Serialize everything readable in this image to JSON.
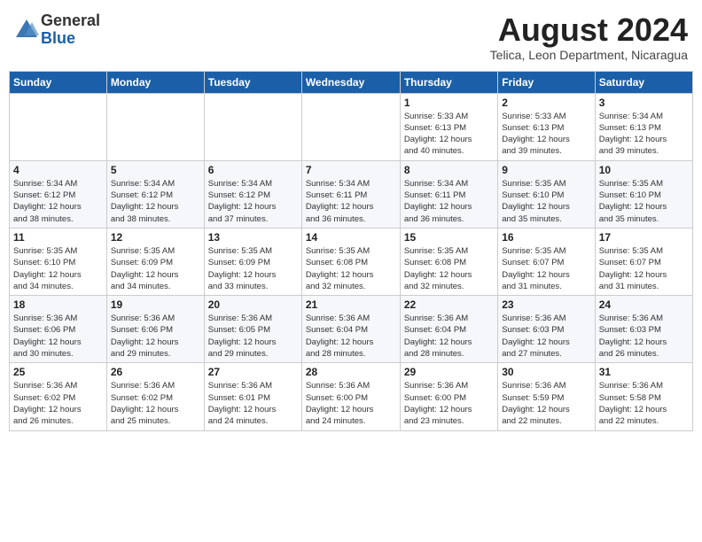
{
  "header": {
    "logo_general": "General",
    "logo_blue": "Blue",
    "title": "August 2024",
    "location": "Telica, Leon Department, Nicaragua"
  },
  "days_of_week": [
    "Sunday",
    "Monday",
    "Tuesday",
    "Wednesday",
    "Thursday",
    "Friday",
    "Saturday"
  ],
  "weeks": [
    [
      {
        "day": "",
        "info": ""
      },
      {
        "day": "",
        "info": ""
      },
      {
        "day": "",
        "info": ""
      },
      {
        "day": "",
        "info": ""
      },
      {
        "day": "1",
        "info": "Sunrise: 5:33 AM\nSunset: 6:13 PM\nDaylight: 12 hours\nand 40 minutes."
      },
      {
        "day": "2",
        "info": "Sunrise: 5:33 AM\nSunset: 6:13 PM\nDaylight: 12 hours\nand 39 minutes."
      },
      {
        "day": "3",
        "info": "Sunrise: 5:34 AM\nSunset: 6:13 PM\nDaylight: 12 hours\nand 39 minutes."
      }
    ],
    [
      {
        "day": "4",
        "info": "Sunrise: 5:34 AM\nSunset: 6:12 PM\nDaylight: 12 hours\nand 38 minutes."
      },
      {
        "day": "5",
        "info": "Sunrise: 5:34 AM\nSunset: 6:12 PM\nDaylight: 12 hours\nand 38 minutes."
      },
      {
        "day": "6",
        "info": "Sunrise: 5:34 AM\nSunset: 6:12 PM\nDaylight: 12 hours\nand 37 minutes."
      },
      {
        "day": "7",
        "info": "Sunrise: 5:34 AM\nSunset: 6:11 PM\nDaylight: 12 hours\nand 36 minutes."
      },
      {
        "day": "8",
        "info": "Sunrise: 5:34 AM\nSunset: 6:11 PM\nDaylight: 12 hours\nand 36 minutes."
      },
      {
        "day": "9",
        "info": "Sunrise: 5:35 AM\nSunset: 6:10 PM\nDaylight: 12 hours\nand 35 minutes."
      },
      {
        "day": "10",
        "info": "Sunrise: 5:35 AM\nSunset: 6:10 PM\nDaylight: 12 hours\nand 35 minutes."
      }
    ],
    [
      {
        "day": "11",
        "info": "Sunrise: 5:35 AM\nSunset: 6:10 PM\nDaylight: 12 hours\nand 34 minutes."
      },
      {
        "day": "12",
        "info": "Sunrise: 5:35 AM\nSunset: 6:09 PM\nDaylight: 12 hours\nand 34 minutes."
      },
      {
        "day": "13",
        "info": "Sunrise: 5:35 AM\nSunset: 6:09 PM\nDaylight: 12 hours\nand 33 minutes."
      },
      {
        "day": "14",
        "info": "Sunrise: 5:35 AM\nSunset: 6:08 PM\nDaylight: 12 hours\nand 32 minutes."
      },
      {
        "day": "15",
        "info": "Sunrise: 5:35 AM\nSunset: 6:08 PM\nDaylight: 12 hours\nand 32 minutes."
      },
      {
        "day": "16",
        "info": "Sunrise: 5:35 AM\nSunset: 6:07 PM\nDaylight: 12 hours\nand 31 minutes."
      },
      {
        "day": "17",
        "info": "Sunrise: 5:35 AM\nSunset: 6:07 PM\nDaylight: 12 hours\nand 31 minutes."
      }
    ],
    [
      {
        "day": "18",
        "info": "Sunrise: 5:36 AM\nSunset: 6:06 PM\nDaylight: 12 hours\nand 30 minutes."
      },
      {
        "day": "19",
        "info": "Sunrise: 5:36 AM\nSunset: 6:06 PM\nDaylight: 12 hours\nand 29 minutes."
      },
      {
        "day": "20",
        "info": "Sunrise: 5:36 AM\nSunset: 6:05 PM\nDaylight: 12 hours\nand 29 minutes."
      },
      {
        "day": "21",
        "info": "Sunrise: 5:36 AM\nSunset: 6:04 PM\nDaylight: 12 hours\nand 28 minutes."
      },
      {
        "day": "22",
        "info": "Sunrise: 5:36 AM\nSunset: 6:04 PM\nDaylight: 12 hours\nand 28 minutes."
      },
      {
        "day": "23",
        "info": "Sunrise: 5:36 AM\nSunset: 6:03 PM\nDaylight: 12 hours\nand 27 minutes."
      },
      {
        "day": "24",
        "info": "Sunrise: 5:36 AM\nSunset: 6:03 PM\nDaylight: 12 hours\nand 26 minutes."
      }
    ],
    [
      {
        "day": "25",
        "info": "Sunrise: 5:36 AM\nSunset: 6:02 PM\nDaylight: 12 hours\nand 26 minutes."
      },
      {
        "day": "26",
        "info": "Sunrise: 5:36 AM\nSunset: 6:02 PM\nDaylight: 12 hours\nand 25 minutes."
      },
      {
        "day": "27",
        "info": "Sunrise: 5:36 AM\nSunset: 6:01 PM\nDaylight: 12 hours\nand 24 minutes."
      },
      {
        "day": "28",
        "info": "Sunrise: 5:36 AM\nSunset: 6:00 PM\nDaylight: 12 hours\nand 24 minutes."
      },
      {
        "day": "29",
        "info": "Sunrise: 5:36 AM\nSunset: 6:00 PM\nDaylight: 12 hours\nand 23 minutes."
      },
      {
        "day": "30",
        "info": "Sunrise: 5:36 AM\nSunset: 5:59 PM\nDaylight: 12 hours\nand 22 minutes."
      },
      {
        "day": "31",
        "info": "Sunrise: 5:36 AM\nSunset: 5:58 PM\nDaylight: 12 hours\nand 22 minutes."
      }
    ]
  ]
}
